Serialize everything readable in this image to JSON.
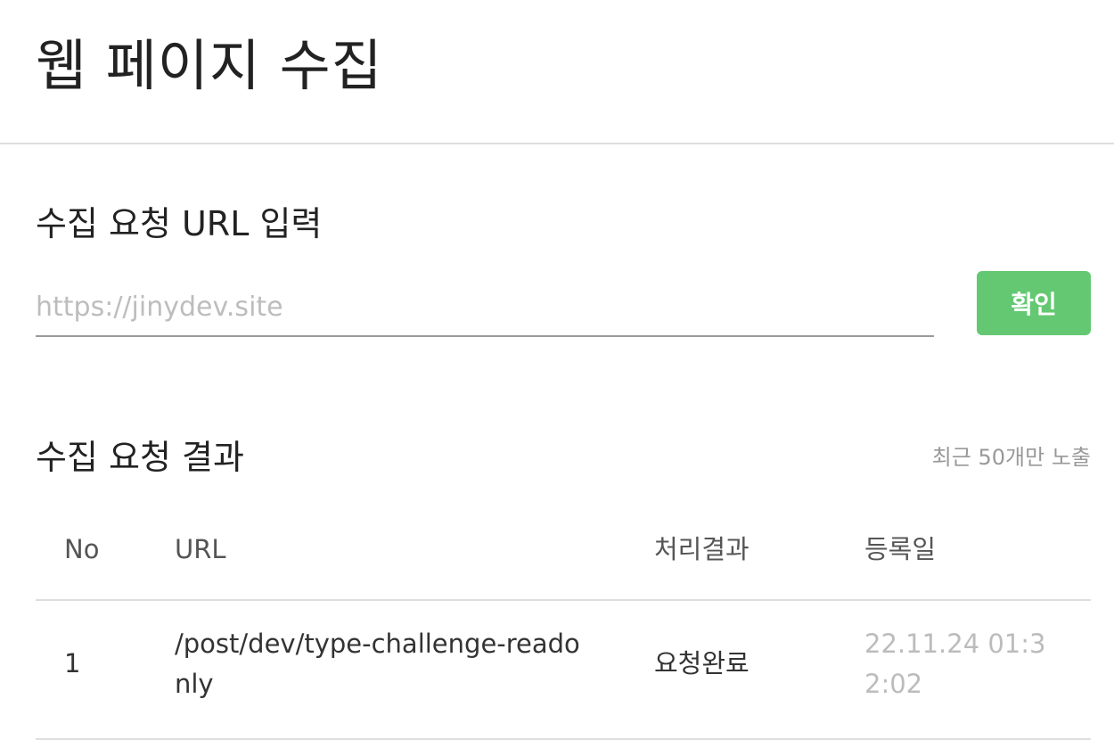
{
  "header": {
    "title": "웹 페이지 수집"
  },
  "input_section": {
    "title": "수집 요청 URL 입력",
    "url_placeholder": "https://jinydev.site",
    "url_value": "",
    "confirm_label": "확인",
    "confirm_color": "#64c872"
  },
  "result_section": {
    "title": "수집 요청 결과",
    "note": "최근 50개만 노출",
    "columns": {
      "no": "No",
      "url": "URL",
      "status": "처리결과",
      "date": "등록일"
    },
    "rows": [
      {
        "no": "1",
        "url": "/post/dev/type-challenge-readonly",
        "status": "요청완료",
        "date": "22.11.24 01:32:02"
      }
    ]
  }
}
